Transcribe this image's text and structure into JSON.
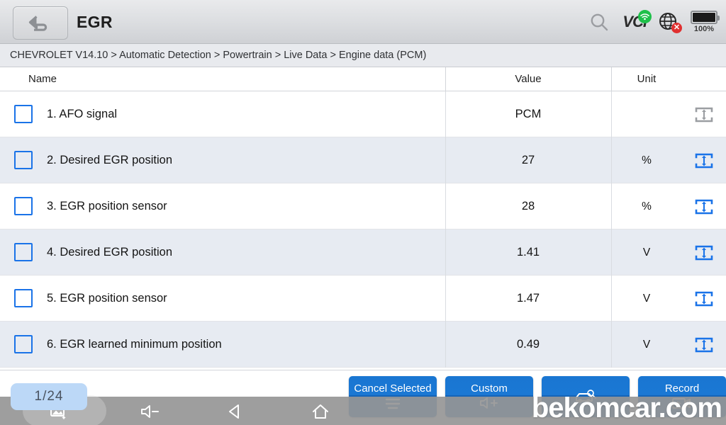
{
  "titlebar": {
    "back_icon": "back-arrow-icon",
    "title": "EGR",
    "search_icon": "search-icon",
    "vci_label": "VCI",
    "vci_badge_icon": "wifi-icon",
    "globe_icon": "globe-icon",
    "globe_badge": "✕",
    "battery_icon": "battery-full-icon",
    "battery_percent": "100%"
  },
  "breadcrumb": {
    "text": "CHEVROLET V14.10 > Automatic Detection  > Powertrain > Live Data  > Engine data (PCM)"
  },
  "table": {
    "headers": {
      "name": "Name",
      "value": "Value",
      "unit": "Unit"
    },
    "rows": [
      {
        "name": "1. AFO signal",
        "value": "PCM",
        "unit": "",
        "graph_icon": "graph-range-icon",
        "graph_enabled": false,
        "checked": false
      },
      {
        "name": "2. Desired EGR position",
        "value": "27",
        "unit": "%",
        "graph_icon": "graph-range-icon",
        "graph_enabled": true,
        "checked": false
      },
      {
        "name": "3. EGR position sensor",
        "value": "28",
        "unit": "%",
        "graph_icon": "graph-range-icon",
        "graph_enabled": true,
        "checked": false
      },
      {
        "name": "4. Desired EGR position",
        "value": "1.41",
        "unit": "V",
        "graph_icon": "graph-range-icon",
        "graph_enabled": true,
        "checked": false
      },
      {
        "name": "5. EGR position sensor",
        "value": "1.47",
        "unit": "V",
        "graph_icon": "graph-range-icon",
        "graph_enabled": true,
        "checked": false
      },
      {
        "name": "6. EGR learned minimum position",
        "value": "0.49",
        "unit": "V",
        "graph_icon": "graph-range-icon",
        "graph_enabled": true,
        "checked": false
      }
    ]
  },
  "actions": [
    {
      "label": "Cancel Selected",
      "icon": "list-lines-icon"
    },
    {
      "label": "Custom",
      "icon": "speaker-plus-icon"
    },
    {
      "label": "",
      "icon": "car-scan-icon"
    },
    {
      "label": "Record",
      "icon": "video-play-icon"
    }
  ],
  "page_indicator": "1/24",
  "navbar": {
    "screenshot_icon": "screenshot-icon",
    "volume_icon": "volume-down-icon",
    "back_icon": "back-triangle-icon",
    "home_icon": "home-icon"
  },
  "watermark": "bekomcar.com",
  "colors": {
    "accent_blue": "#1a73e8",
    "button_blue": "#1565b8",
    "row_alt": "#e7ebf2",
    "breadcrumb_bg": "#e8eaee",
    "navbar_gray": "#9a9a9a"
  }
}
